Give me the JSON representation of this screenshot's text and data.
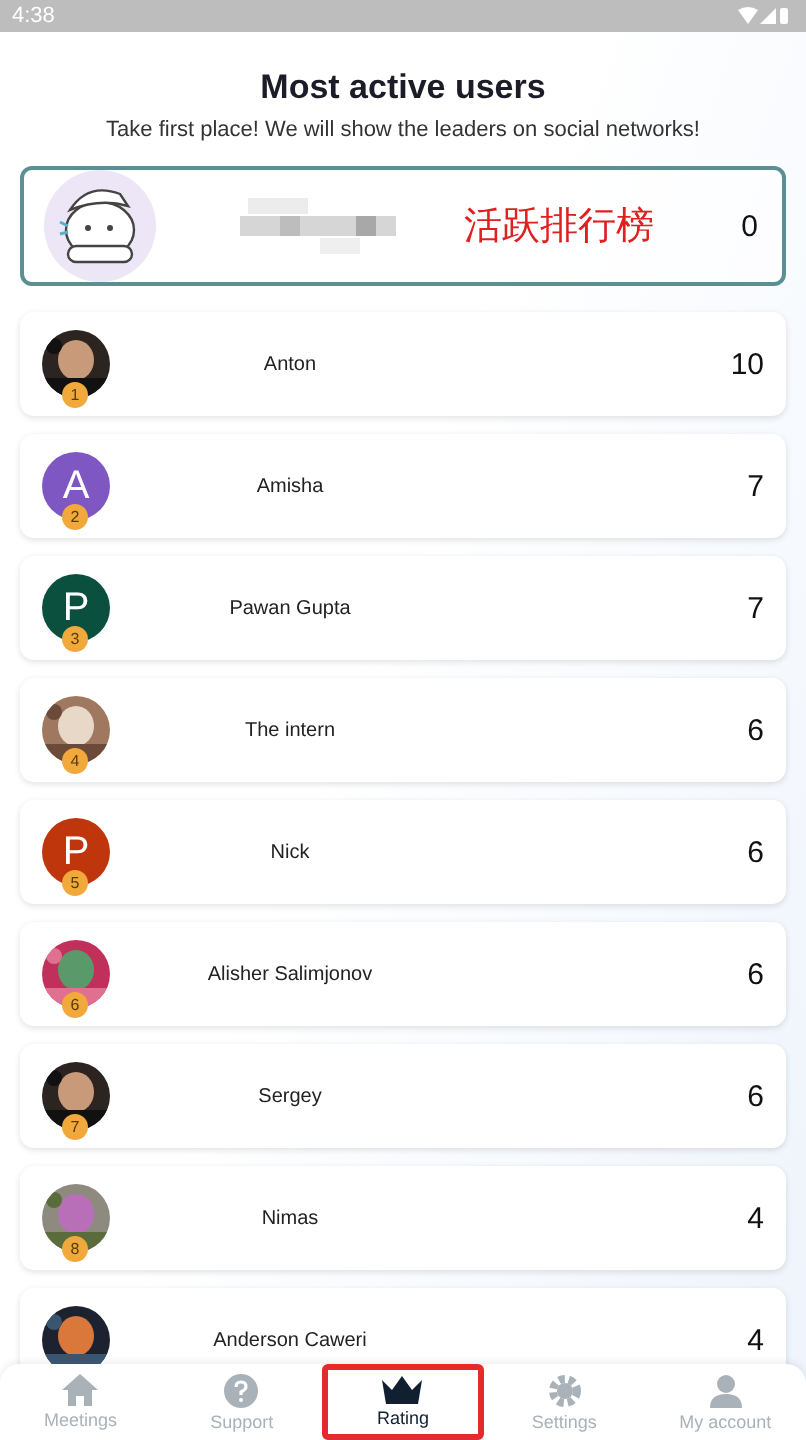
{
  "status_bar": {
    "time": "4:38"
  },
  "title": "Most active users",
  "subtitle": "Take first place! We will show the leaders on social networks!",
  "current_user": {
    "annotation": "活跃排行榜",
    "score": "0"
  },
  "users": [
    {
      "rank": "1",
      "name": "Anton",
      "score": "10"
    },
    {
      "rank": "2",
      "name": "Amisha",
      "score": "7",
      "avatar": {
        "kind": "letter",
        "letter": "A",
        "color": "#7e57c2"
      }
    },
    {
      "rank": "3",
      "name": "Pawan Gupta",
      "score": "7",
      "avatar": {
        "kind": "letter",
        "letter": "P",
        "color": "#0b4f3f"
      }
    },
    {
      "rank": "4",
      "name": "The intern",
      "score": "6"
    },
    {
      "rank": "5",
      "name": "Nick",
      "score": "6",
      "avatar": {
        "kind": "letter",
        "letter": "P",
        "color": "#bf360c"
      }
    },
    {
      "rank": "6",
      "name": "Alisher Salimjonov",
      "score": "6"
    },
    {
      "rank": "7",
      "name": "Sergey",
      "score": "6"
    },
    {
      "rank": "8",
      "name": "Nimas",
      "score": "4"
    },
    {
      "name": "Anderson Caweri",
      "score": "4"
    }
  ],
  "nav": [
    {
      "kind": "home",
      "label": "Meetings",
      "selected": false
    },
    {
      "kind": "help",
      "label": "Support",
      "selected": false
    },
    {
      "kind": "crown",
      "label": "Rating",
      "selected": true
    },
    {
      "kind": "gear",
      "label": "Settings",
      "selected": false
    },
    {
      "kind": "person",
      "label": "My account",
      "selected": false
    }
  ]
}
